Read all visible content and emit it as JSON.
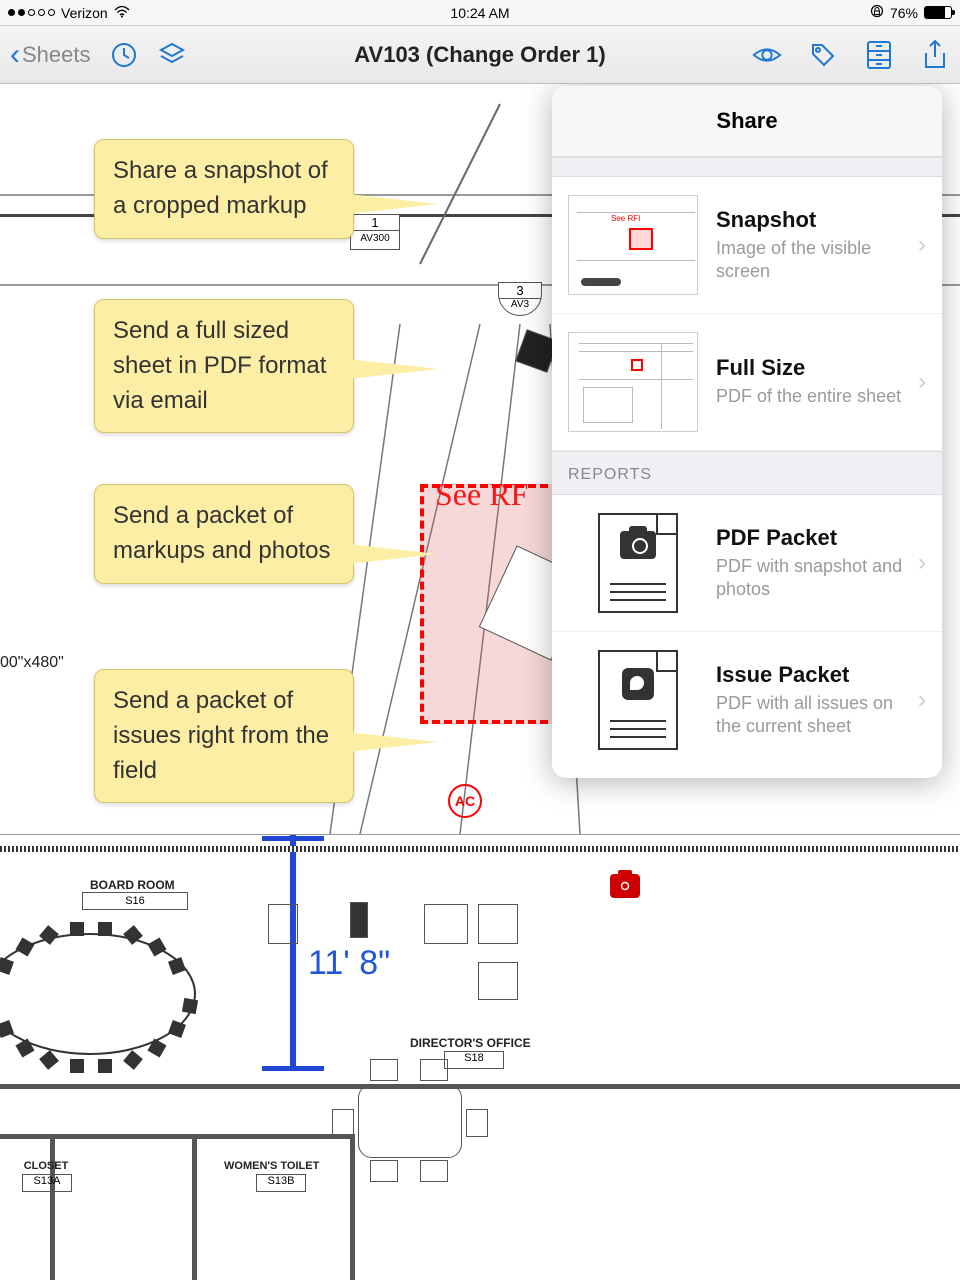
{
  "status": {
    "carrier": "Verizon",
    "time": "10:24 AM",
    "battery_pct": "76%"
  },
  "nav": {
    "back_label": "Sheets",
    "title": "AV103 (Change Order 1)"
  },
  "callouts": {
    "c1": "Share a snapshot of a cropped markup",
    "c2": "Send a full sized sheet in PDF format via email",
    "c3": "Send a packet of markups and photos",
    "c4": "Send a packet of issues right from the field"
  },
  "share": {
    "header": "Share",
    "items": [
      {
        "title": "Snapshot",
        "sub": "Image of the visible screen"
      },
      {
        "title": "Full Size",
        "sub": "PDF of the entire sheet"
      }
    ],
    "reports_label": "REPORTS",
    "reports": [
      {
        "title": "PDF Packet",
        "sub": "PDF with snapshot and photos"
      },
      {
        "title": "Issue Packet",
        "sub": "PDF with all issues on the current sheet"
      }
    ]
  },
  "blueprint": {
    "board_room": "BOARD ROOM",
    "board_room_id": "S16",
    "directors": "DIRECTOR'S OFFICE",
    "directors_id": "S18",
    "closet": "CLOSET",
    "closet_id": "S13A",
    "womens": "WOMEN'S TOILET",
    "womens_id": "S13B",
    "dim_label": "00\"x480\"",
    "av_symbol_1": "1",
    "av_symbol_1b": "AV300",
    "av_symbol_2": "3",
    "av_symbol_2b": "AV3",
    "red_label": "See RF",
    "ac_label": "AC",
    "measure": "11' 8\""
  }
}
